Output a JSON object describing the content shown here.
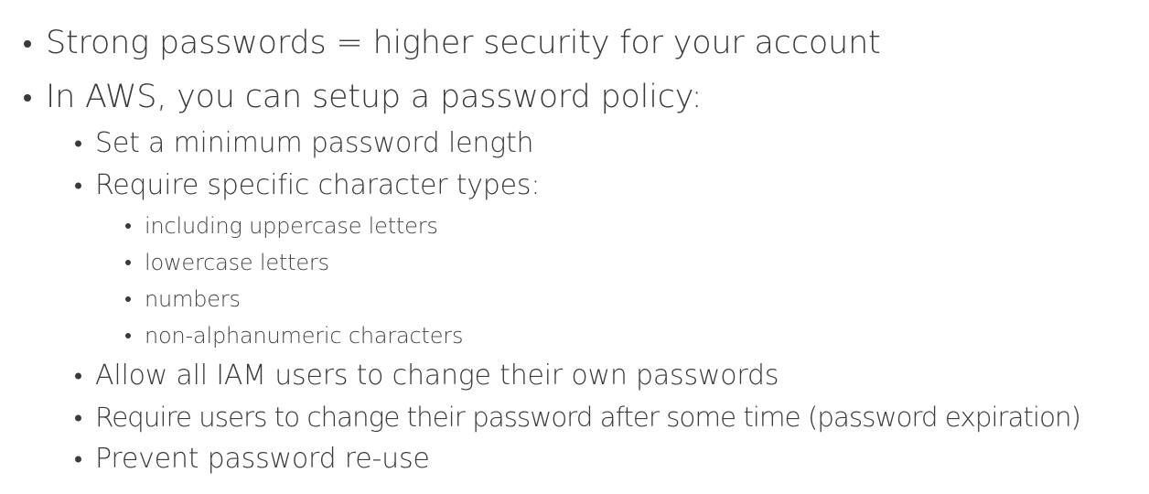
{
  "bullets": {
    "b1": "Strong passwords = higher security for your account",
    "b2": "In AWS, you can setup a password policy:",
    "b2_1": "Set a minimum password length",
    "b2_2": "Require specific character types:",
    "b2_2_1": "including uppercase letters",
    "b2_2_2": "lowercase letters",
    "b2_2_3": "numbers",
    "b2_2_4": "non-alphanumeric characters",
    "b2_3": "Allow all IAM users to change their own passwords",
    "b2_4": "Require users to change their password after some time (password expiration)",
    "b2_5": "Prevent password re-use"
  },
  "colors": {
    "text": "#3a3a3a",
    "background": "#ffffff"
  }
}
